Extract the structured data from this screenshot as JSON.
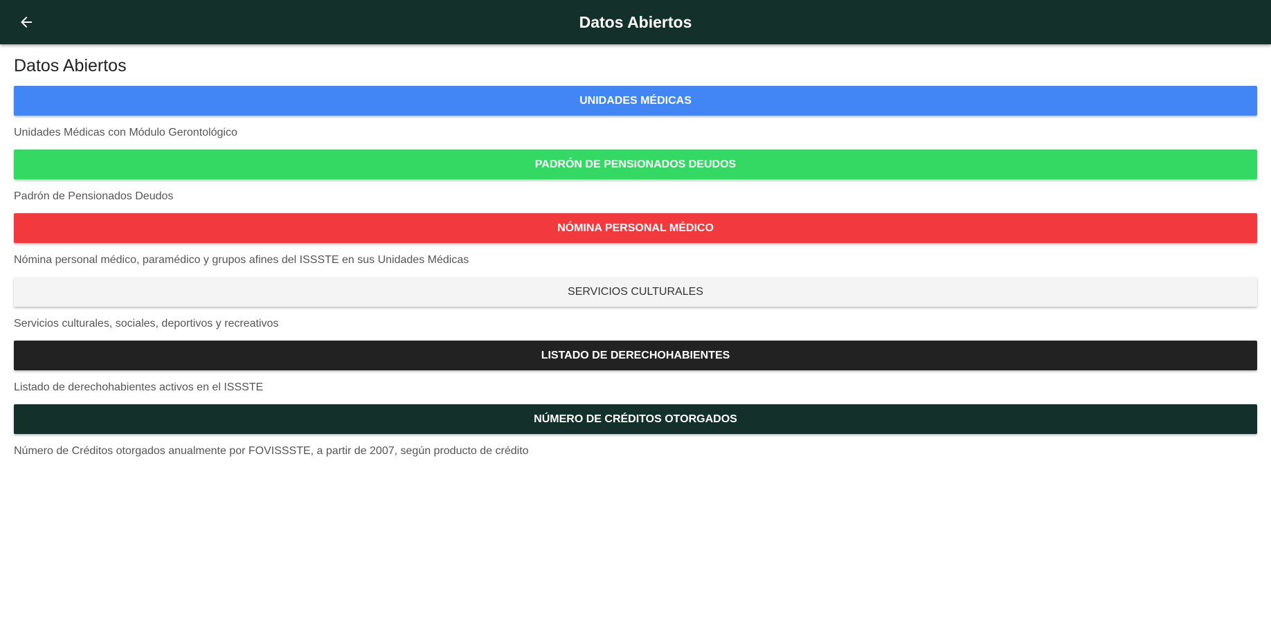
{
  "app_bar": {
    "title": "Datos Abiertos",
    "back_icon": "arrow-left-icon"
  },
  "page": {
    "heading": "Datos Abiertos"
  },
  "datasets": [
    {
      "label": "UNIDADES MÉDICAS",
      "description": "Unidades Médicas con Módulo Gerontológico",
      "color": "#4285f4",
      "text_color": "#ffffff"
    },
    {
      "label": "PADRÓN DE PENSIONADOS DEUDOS",
      "description": "Padrón de Pensionados Deudos",
      "color": "#34d964",
      "text_color": "#ffffff"
    },
    {
      "label": "NÓMINA PERSONAL MÉDICO",
      "description": "Nómina personal médico, paramédico y grupos afines del ISSSTE en sus Unidades Médicas",
      "color": "#f2393d",
      "text_color": "#ffffff"
    },
    {
      "label": "SERVICIOS CULTURALES",
      "description": "Servicios culturales, sociales, deportivos y recreativos",
      "color": "#f4f4f4",
      "text_color": "#333333"
    },
    {
      "label": "LISTADO DE DERECHOHABIENTES",
      "description": "Listado de derechohabientes activos en el ISSSTE",
      "color": "#222222",
      "text_color": "#ffffff"
    },
    {
      "label": "NÚMERO DE CRÉDITOS OTORGADOS",
      "description": "Número de Créditos otorgados anualmente por FOVISSSTE, a partir de 2007, según producto de crédito",
      "color": "#13312a",
      "text_color": "#ffffff"
    }
  ]
}
